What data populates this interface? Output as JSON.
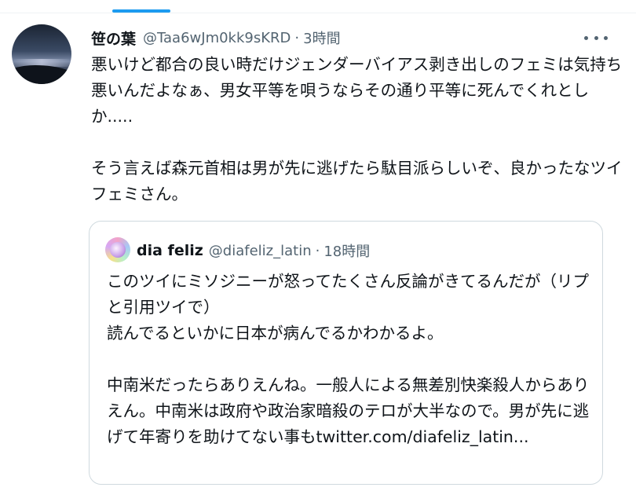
{
  "tweet": {
    "display_name": "笹の葉",
    "handle": "@Taa6wJm0kk9sKRD",
    "separator": "·",
    "time": "3時間",
    "text": "悪いけど都合の良い時だけジェンダーバイアス剥き出しのフェミは気持ち悪いんだよなぁ、男女平等を唄うならその通り平等に死んでくれとしか.....\n\nそう言えば森元首相は男が先に逃げたら駄目派らしいぞ、良かったなツイフェミさん。",
    "avatar_icon": "user-avatar-night-sky"
  },
  "quote": {
    "display_name": "dia feliz",
    "handle": "@diafeliz_latin",
    "separator": "·",
    "time": "18時間",
    "text": "このツイにミソジニーが怒ってたくさん反論がきてるんだが（リプと引用ツイで）\n読んでるといかに日本が病んでるかわかるよ。\n\n中南米だったらありえんね。一般人による無差別快楽殺人からありえん。中南米は政府や政治家暗殺のテロが大半なので。男が先に逃げて年寄りを助けてない事もtwitter.com/diafeliz_latin...",
    "avatar_icon": "user-avatar-colorful"
  },
  "icons": {
    "more": "more-horizontal-icon"
  },
  "colors": {
    "accent": "#1d9bf0",
    "text_primary": "#0f1419",
    "text_secondary": "#536471",
    "border": "#cfd9de"
  }
}
